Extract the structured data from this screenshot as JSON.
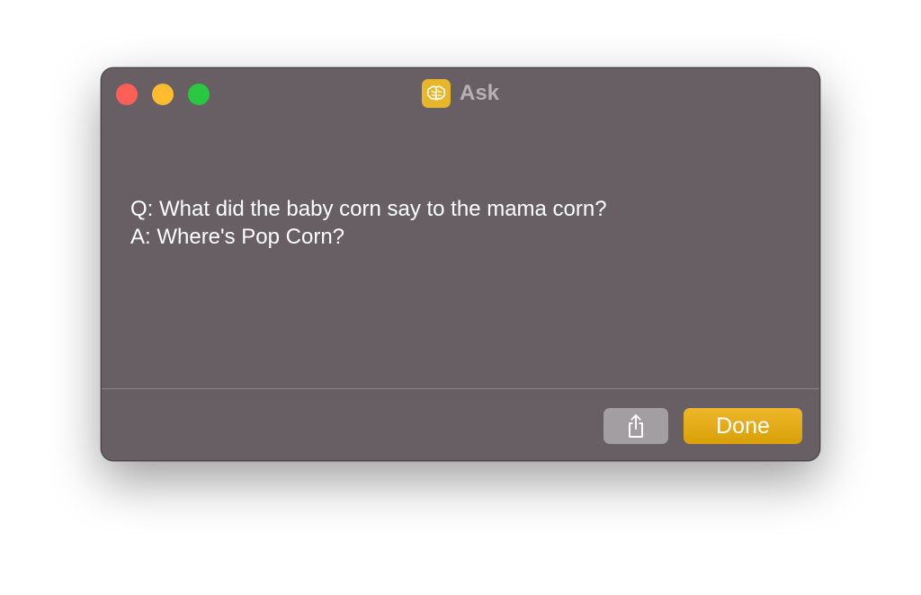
{
  "window": {
    "title": "Ask",
    "app_icon": "brain-icon",
    "app_icon_color": "#e8b62a"
  },
  "traffic_lights": [
    {
      "name": "close",
      "color": "#fe5f57"
    },
    {
      "name": "minimize",
      "color": "#febc2e"
    },
    {
      "name": "zoom",
      "color": "#28c840"
    }
  ],
  "message": {
    "question": "Q: What did the baby corn say to the mama corn?",
    "answer": "A: Where's Pop Corn?"
  },
  "buttons": {
    "share_icon": "share-icon",
    "done_label": "Done",
    "done_color": "#e3aa16"
  }
}
